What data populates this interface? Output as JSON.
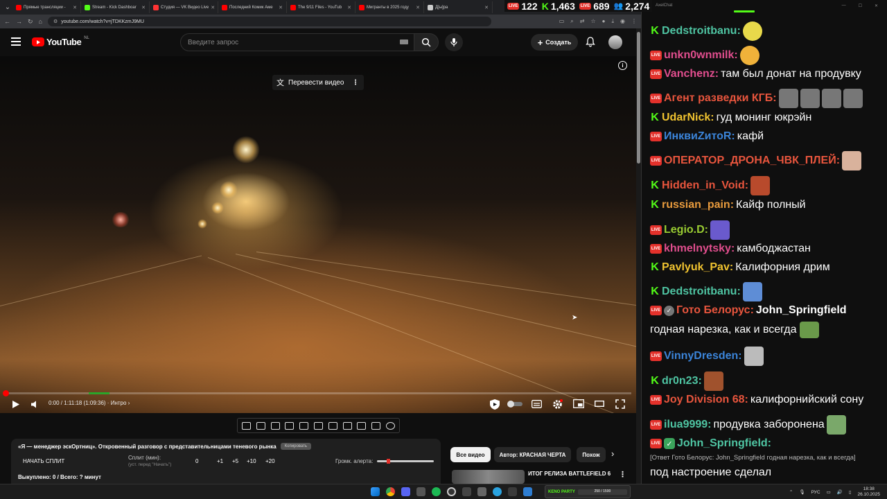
{
  "browser": {
    "tabs": [
      {
        "label": "Прямые трансляции -",
        "color": "#ff0000"
      },
      {
        "label": "Stream - Kick Dashboar",
        "color": "#53fc18"
      },
      {
        "label": "Студия — VK Видео Live",
        "color": "#ff3333"
      },
      {
        "label": "Последний Комик Аме",
        "color": "#ff0000"
      },
      {
        "label": "The 9/11 Files - YouTub",
        "color": "#ff0000"
      },
      {
        "label": "Мигранты в 2025 году",
        "color": "#ff0000"
      },
      {
        "label": "Д[ы]ра",
        "color": "#cccccc"
      }
    ],
    "url": "youtube.com/watch?v=jTDKKzmJ9MU"
  },
  "stream_stats": {
    "youtube_viewers": "122",
    "kick_viewers": "1,463",
    "vk_viewers": "689",
    "total_viewers": "2,274",
    "live_label": "LIVE"
  },
  "youtube": {
    "logo_text": "YouTube",
    "region": "NL",
    "search_placeholder": "Введите запрос",
    "create_label": "Создать",
    "translate_label": "Перевести видео",
    "time": "0:00 / 1:11:18 (1:09:36)",
    "chapter": "Интро",
    "progress_fraction": 0,
    "chips": [
      "Все видео",
      "Автор: КРАСНАЯ ЧЕРТА",
      "Похож"
    ],
    "rec_title": "ИТОГ РЕЛИЗА BATTLEFIELD 6"
  },
  "split_panel": {
    "title": "«Я — менеджер эскОртниц». Откровенный разговор с представительницами теневого рынка",
    "copy_label": "Копировать",
    "start_label": "НАЧАТЬ СПЛИТ",
    "split_min_label": "Сплит (мин):",
    "split_hint": "(уст. перед \"Начать\")",
    "split_value": "0",
    "increments": [
      "+1",
      "+5",
      "+10",
      "+20"
    ],
    "alert_label": "Громк. алерта:",
    "footer": "Выкуплено: 0 / Всего: ? минут"
  },
  "chat": {
    "app_title": "AxelChat",
    "messages": [
      {
        "platform": "kick",
        "name": "Dedstroitbanu:",
        "color": "#4fc5a3",
        "text": "",
        "emote": "#e8d94a"
      },
      {
        "platform": "yt",
        "name": "unkn0wnmilk:",
        "color": "#e14e8e",
        "text": "",
        "emote": "#f0b23a"
      },
      {
        "platform": "yt",
        "name": "Vanchenz:",
        "color": "#e14e8e",
        "text": "там был донат на продувку",
        "emote": ""
      },
      {
        "platform": "yt",
        "name": "Агент разведки КГБ:",
        "color": "#e8553d",
        "text": "",
        "emote": "#777"
      },
      {
        "platform": "kick",
        "name": "UdarNick:",
        "color": "#f0c330",
        "text": "гуд монинг юкрэйн",
        "emote": ""
      },
      {
        "platform": "yt",
        "name": "ИнквиZитоR:",
        "color": "#3b84d9",
        "text": "кафй",
        "emote": ""
      },
      {
        "platform": "yt",
        "name": "ОПЕРАТОР_ДРОНА_ЧВК_ПЛЕЙ:",
        "color": "#e8553d",
        "text": "",
        "emote": "#d9b29c"
      },
      {
        "platform": "kick",
        "name": "Hidden_in_Void:",
        "color": "#e8553d",
        "text": "",
        "emote": "#b84a2c"
      },
      {
        "platform": "kick",
        "name": "russian_pain:",
        "color": "#e89b3d",
        "text": "Кайф полный",
        "emote": ""
      },
      {
        "platform": "yt",
        "name": "Legio.D:",
        "color": "#9acd32",
        "text": "",
        "emote": "#6a5acd"
      },
      {
        "platform": "yt",
        "name": "khmelnytsky:",
        "color": "#e14e8e",
        "text": "камбоджастан",
        "emote": ""
      },
      {
        "platform": "kick",
        "name": "Pavlyuk_Pav:",
        "color": "#f0c330",
        "text": "Калифорния дрим",
        "emote": ""
      },
      {
        "platform": "kick",
        "name": "Dedstroitbanu:",
        "color": "#4fc5a3",
        "text": "",
        "emote": "#5e8dd6"
      },
      {
        "platform": "yt",
        "name": "Гото Белорус:",
        "color": "#e8553d",
        "text": "John_Springfield",
        "emote": ""
      },
      {
        "platform": "yt",
        "name": "VinnyDresden:",
        "color": "#3b84d9",
        "text": "",
        "emote": "#bbb"
      },
      {
        "platform": "kick",
        "name": "dr0n23:",
        "color": "#4fc5a3",
        "text": "",
        "emote": "#a0522d"
      },
      {
        "platform": "yt",
        "name": "Joy Division 68:",
        "color": "#e8553d",
        "text": "калифорнийский сону",
        "emote": ""
      },
      {
        "platform": "yt",
        "name": "ilua9999:",
        "color": "#4fc5a3",
        "text": "продувка заборонена",
        "emote": "#7aa86a"
      },
      {
        "platform": "yt",
        "name": "John_Springfield:",
        "color": "#4fc5a3",
        "text": "",
        "emote": ""
      }
    ],
    "continuation": "годная нарезка, как и всегда",
    "reply_quote": "[Ответ Гото Белорус: John_Springfield годная нарезка, как и всегда]",
    "last_text": "под настроение сделал"
  },
  "taskbar": {
    "kick_widget_label": "KENO PARTY",
    "kick_widget_value": "250 / 1500",
    "lang": "РУС",
    "time": "18:38",
    "date": "26.10.2025"
  }
}
